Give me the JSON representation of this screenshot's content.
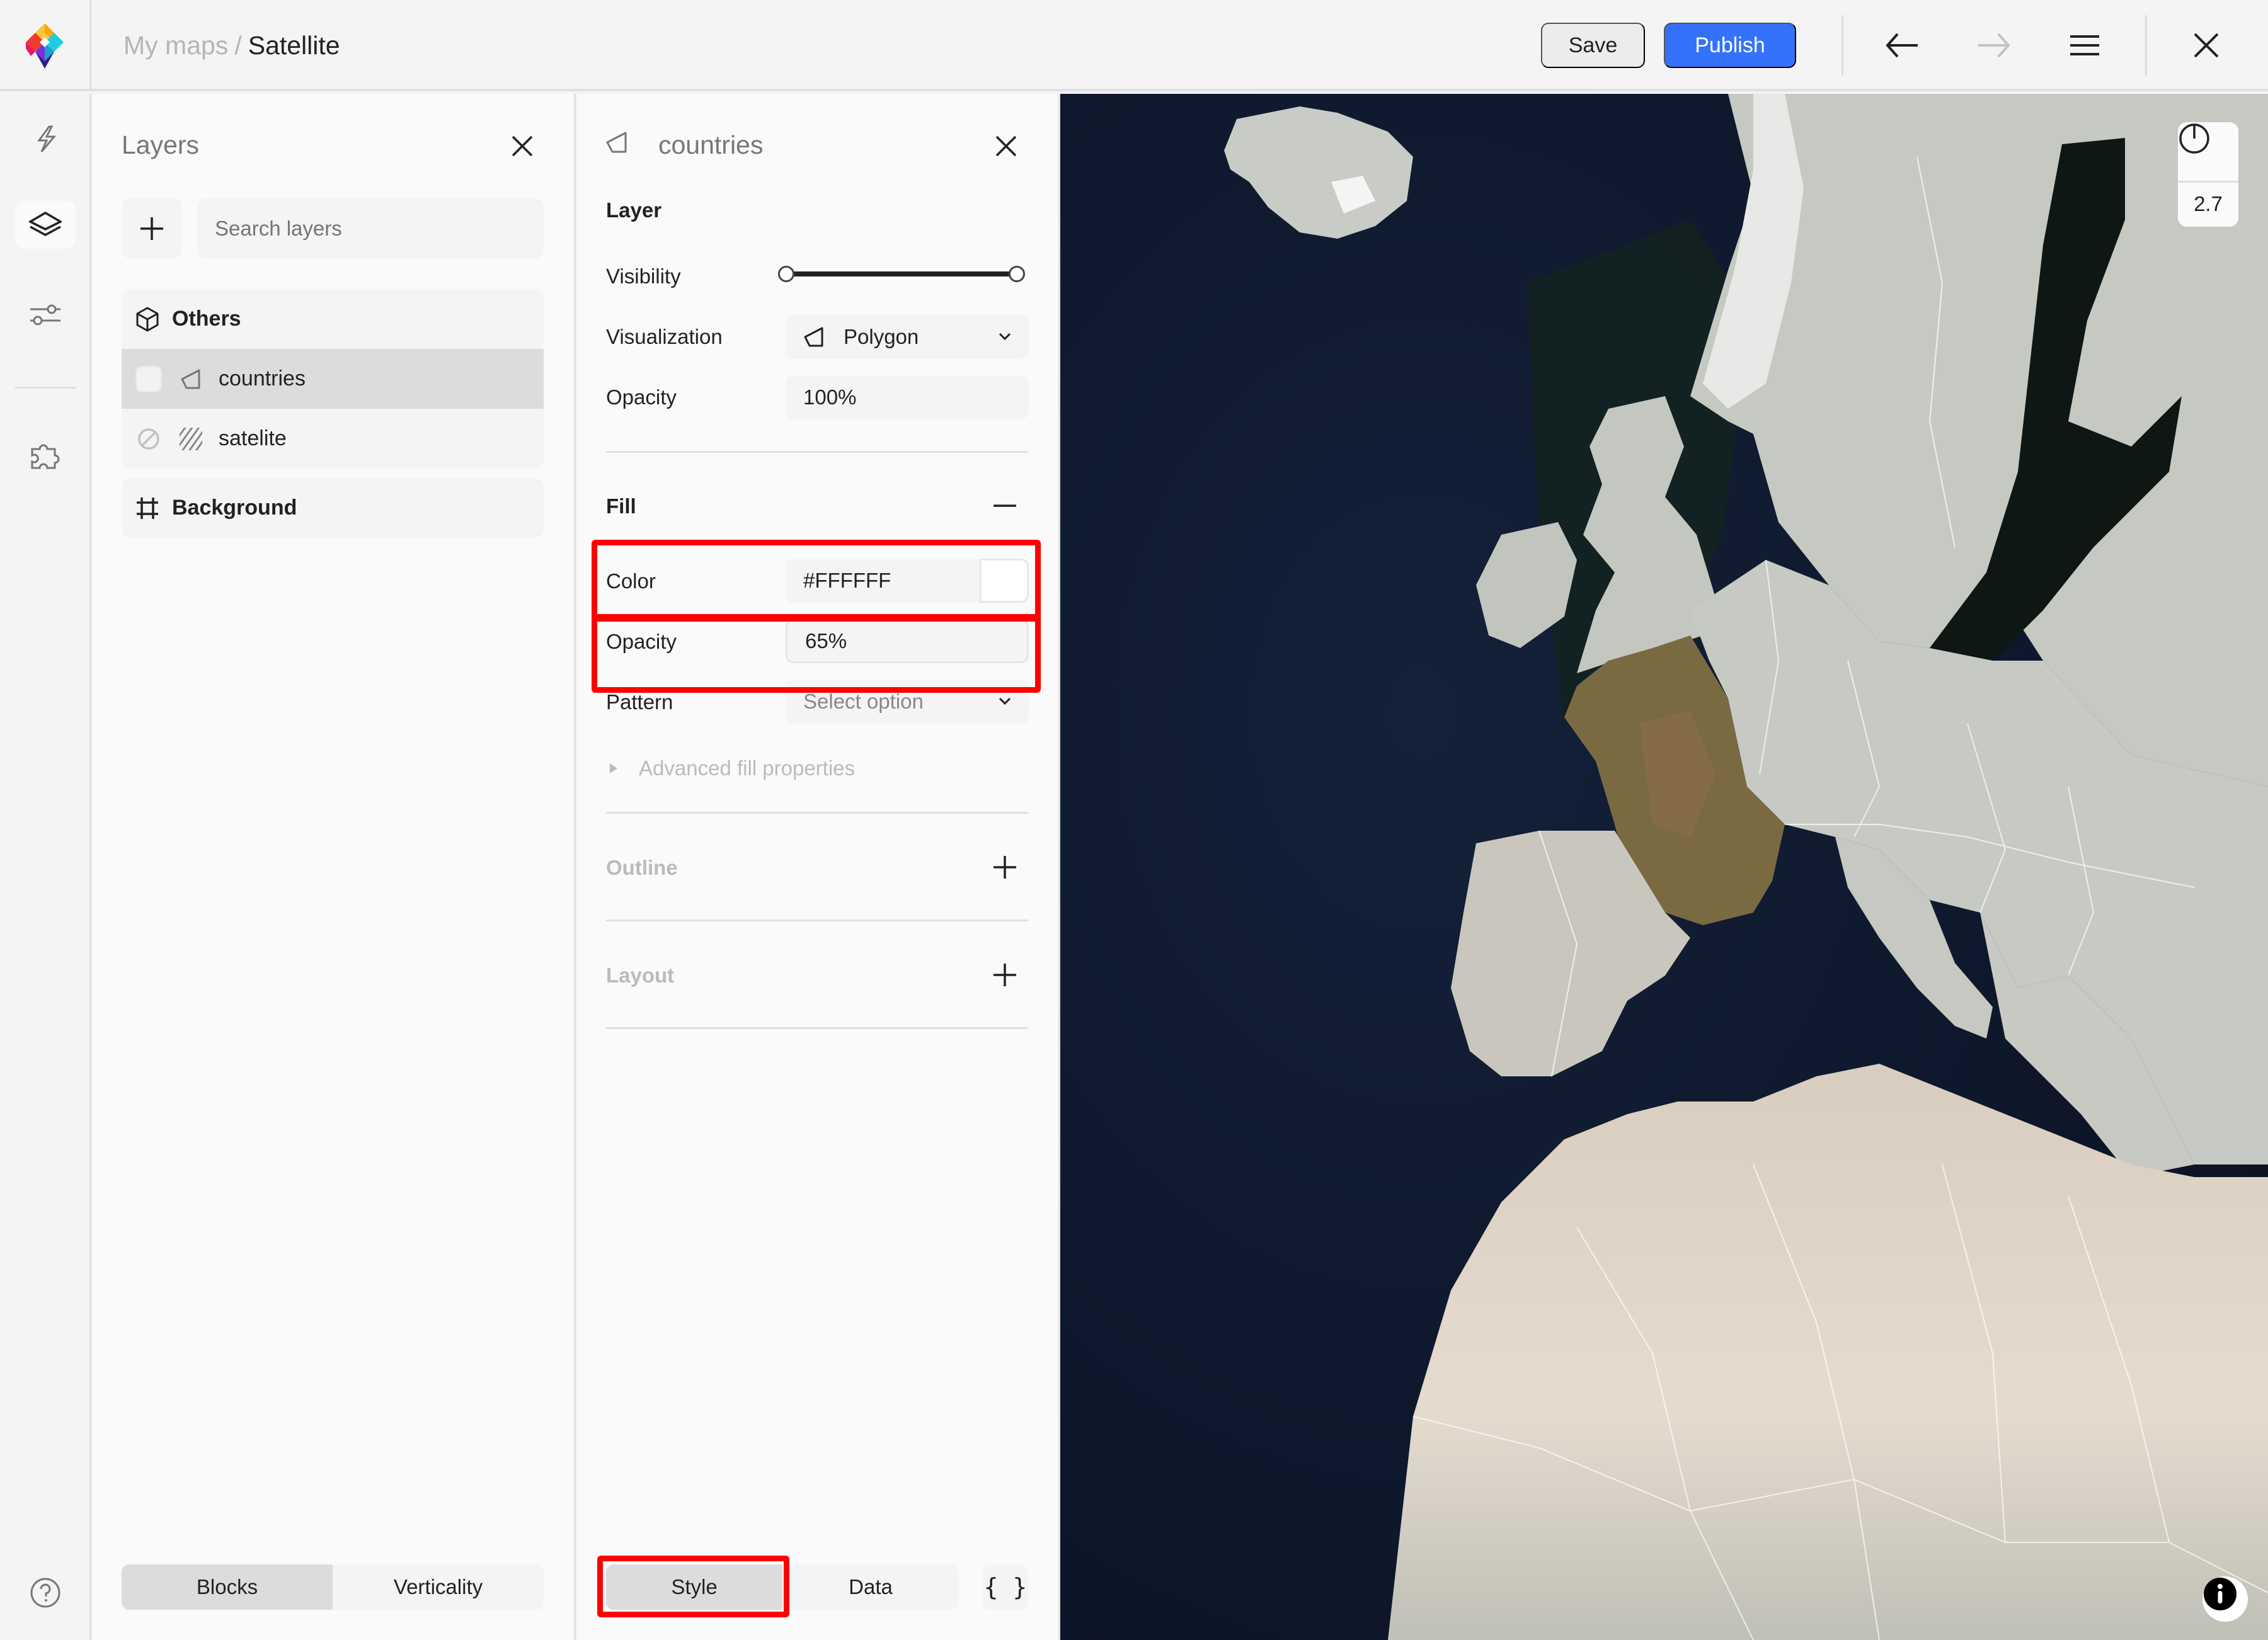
{
  "app": {
    "logo": "app-logo",
    "breadcrumb": {
      "parent": "My maps",
      "separator": "/",
      "current": "Satellite"
    }
  },
  "toolbar": {
    "save_label": "Save",
    "publish_label": "Publish",
    "undo_icon": "arrow-left-icon",
    "redo_icon": "arrow-right-icon",
    "menu_icon": "hamburger-menu-icon",
    "close_icon": "close-icon",
    "publish_color": "#3572FB"
  },
  "rail": {
    "items": [
      {
        "name": "quick-actions",
        "icon": "lightning-icon",
        "active": false
      },
      {
        "name": "layers",
        "icon": "layers-icon",
        "active": true
      },
      {
        "name": "adjustments",
        "icon": "sliders-icon",
        "active": false
      },
      {
        "name": "plugins",
        "icon": "puzzle-icon",
        "active": false
      }
    ],
    "help_icon": "help-circle-icon"
  },
  "layers_panel": {
    "title": "Layers",
    "search_placeholder": "Search layers",
    "groups": [
      {
        "name": "Others",
        "icon": "cube-icon",
        "layers": [
          {
            "name": "countries",
            "type_icon": "polygon-icon",
            "visible": true,
            "selected": true
          },
          {
            "name": "satelite",
            "type_icon": "raster-hatch-icon",
            "visible": false,
            "selected": false
          }
        ]
      }
    ],
    "background": {
      "label": "Background",
      "icon": "frame-icon"
    },
    "view_tabs": [
      {
        "label": "Blocks",
        "active": true
      },
      {
        "label": "Verticality",
        "active": false
      }
    ]
  },
  "properties_panel": {
    "layer_name": "countries",
    "layer_icon": "polygon-icon",
    "layer_section": {
      "title": "Layer",
      "visibility_label": "Visibility",
      "visibility_range": [
        0,
        1
      ],
      "visualization_label": "Visualization",
      "visualization_value": "Polygon",
      "opacity_label": "Opacity",
      "opacity_value": "100%"
    },
    "fill_section": {
      "title": "Fill",
      "color_label": "Color",
      "color_value": "#FFFFFF",
      "opacity_label": "Opacity",
      "opacity_value": "65%",
      "pattern_label": "Pattern",
      "pattern_placeholder": "Select option",
      "advanced_label": "Advanced fill properties"
    },
    "outline_section": {
      "title": "Outline"
    },
    "layout_section": {
      "title": "Layout"
    },
    "tabs": [
      {
        "label": "Style",
        "active": true
      },
      {
        "label": "Data",
        "active": false
      }
    ],
    "json_button_label": "{ }"
  },
  "map": {
    "zoom_level": "2.7",
    "compass_icon": "compass-icon",
    "info_icon": "info-icon",
    "ocean_color": "#0E1626",
    "land_overlay_color": "#C8C9C4",
    "highlight_color": "#FF0000"
  }
}
